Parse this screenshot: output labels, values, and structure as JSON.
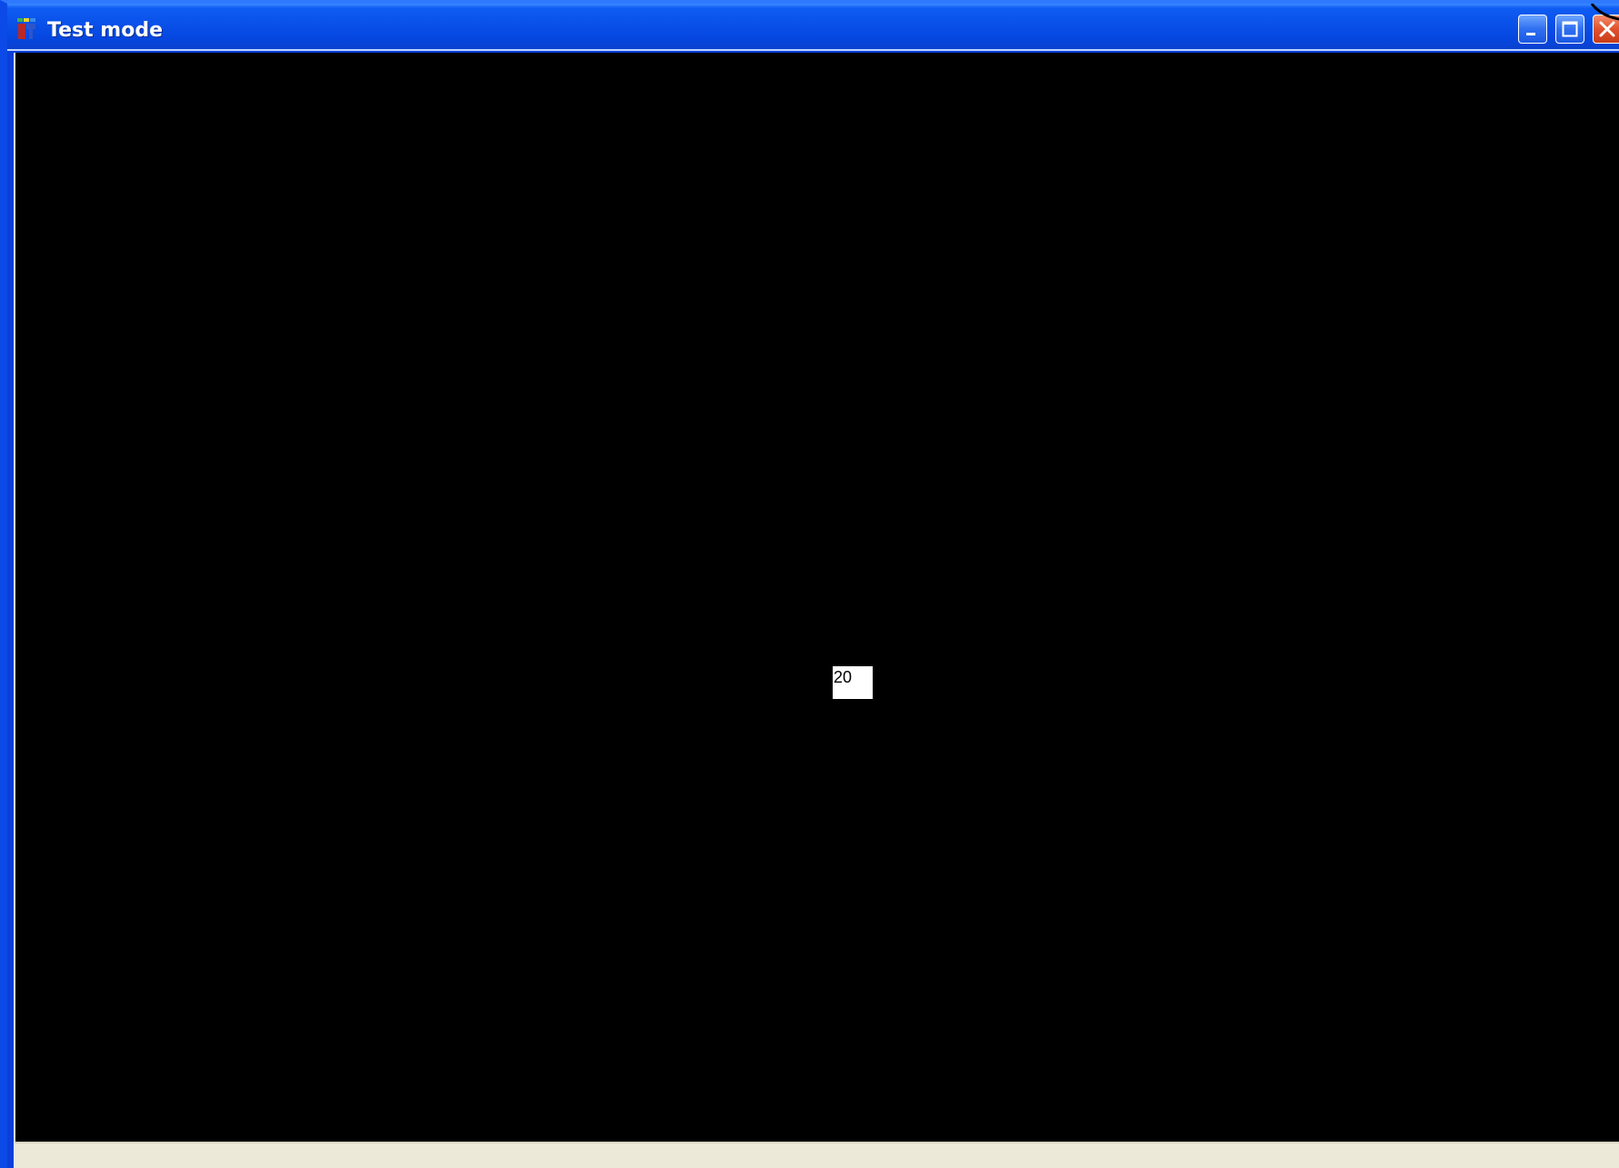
{
  "window": {
    "title": "Test mode",
    "icon": "app-icon",
    "controls": {
      "minimize_icon": "minimize-icon",
      "maximize_icon": "maximize-icon",
      "close_icon": "close-icon"
    }
  },
  "client": {
    "background": "#000000",
    "value_box": {
      "text": "20"
    }
  },
  "colors": {
    "titlebar": "#0a52ea",
    "statusbar": "#ece9d8",
    "close_button": "#e0522d"
  }
}
